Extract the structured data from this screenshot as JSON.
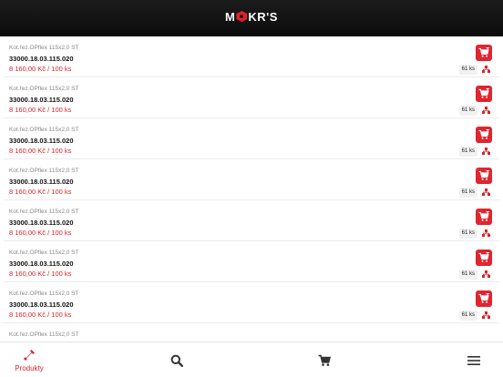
{
  "header": {
    "logo_left": "M",
    "logo_right": "KR'S"
  },
  "products": [
    {
      "name": "Kot.řez.OPflex 115x2,0 ST",
      "code": "33000.18.03.115.020",
      "price": "8 160,00 Kč / 100 ks",
      "stock": "61 ks"
    },
    {
      "name": "Kot.řez.OPflex 115x2,0 ST",
      "code": "33000.18.03.115.020",
      "price": "8 160,00 Kč / 100 ks",
      "stock": "61 ks"
    },
    {
      "name": "Kot.řez.OPflex 115x2,0 ST",
      "code": "33000.18.03.115.020",
      "price": "8 160,00 Kč / 100 ks",
      "stock": "61 ks"
    },
    {
      "name": "Kot.řez.OPflex 115x2,0 ST",
      "code": "33000.18.03.115.020",
      "price": "8 160,00 Kč / 100 ks",
      "stock": "61 ks"
    },
    {
      "name": "Kot.řez.OPflex 115x2,0 ST",
      "code": "33000.18.03.115.020",
      "price": "8 160,00 Kč / 100 ks",
      "stock": "61 ks"
    },
    {
      "name": "Kot.řez.OPflex 115x2,0 ST",
      "code": "33000.18.03.115.020",
      "price": "8 160,00 Kč / 100 ks",
      "stock": "61 ks"
    },
    {
      "name": "Kot.řez.OPflex 115x2,0 ST",
      "code": "33000.18.03.115.020",
      "price": "8 160,00 Kč / 100 ks",
      "stock": "61 ks"
    },
    {
      "name": "Kot.řez.OPflex 115x2,0 ST",
      "code": "",
      "price": "",
      "stock": ""
    }
  ],
  "tabbar": {
    "products_label": "Produkty",
    "active_color": "#d8232a",
    "icons": [
      "wrench-icon",
      "search-icon",
      "cart-icon",
      "menu-icon"
    ]
  },
  "colors": {
    "accent": "#e02530",
    "header_bg": "#111111"
  }
}
